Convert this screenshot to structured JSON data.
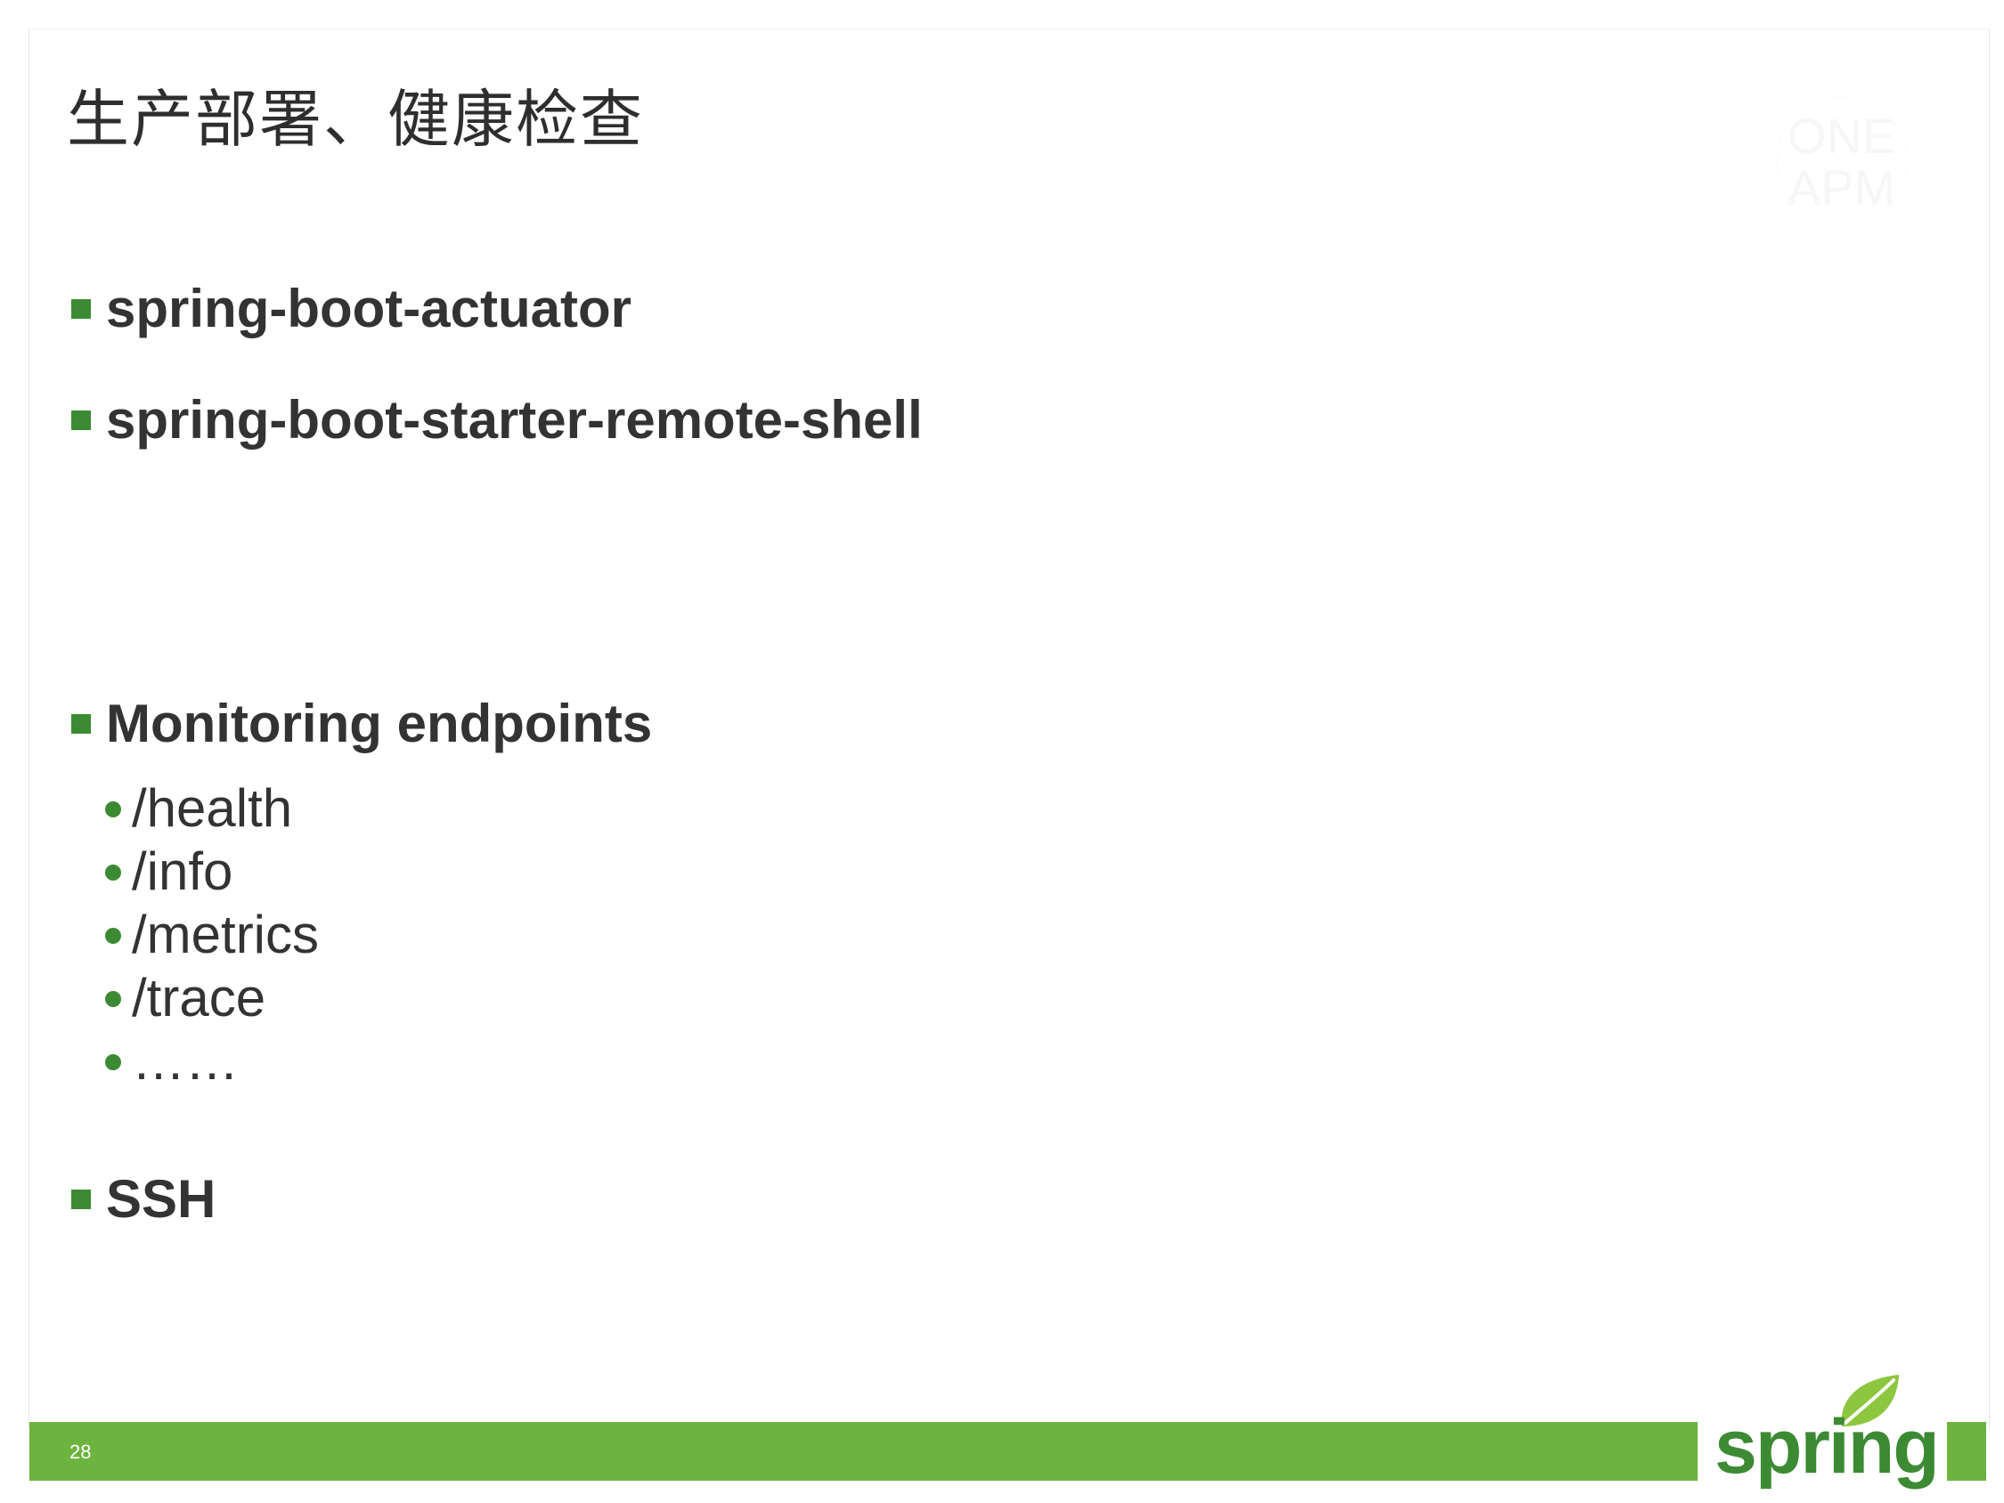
{
  "slide": {
    "title": "生产部署、健康检查",
    "page_number": "28"
  },
  "bullets": [
    {
      "label": "spring-boot-actuator"
    },
    {
      "label": "spring-boot-starter-remote-shell"
    },
    {
      "label": "Monitoring endpoints"
    },
    {
      "label": "SSH"
    }
  ],
  "endpoints": [
    {
      "label": "/health"
    },
    {
      "label": "/info"
    },
    {
      "label": "/metrics"
    },
    {
      "label": "/trace"
    },
    {
      "label": "……"
    }
  ],
  "watermark": {
    "text_line1": "ONE",
    "text_line2": "APM"
  },
  "logo": {
    "wordmark": "spring",
    "icon": "leaf-icon"
  },
  "colors": {
    "brand_green": "#6db33f",
    "bullet_green": "#3c8a33",
    "text": "#333333"
  }
}
